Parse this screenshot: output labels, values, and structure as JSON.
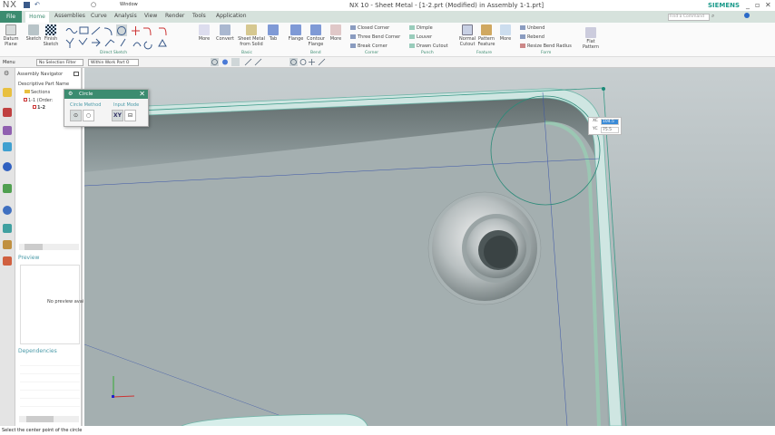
{
  "app": {
    "logo": "NX",
    "title": "NX 10 - Sheet Metal - [1-2.prt (Modified)  in Assembly 1-1.prt]",
    "brand": "SIEMENS",
    "window_menu": "Window",
    "accent": "#3c8c70"
  },
  "tabs": [
    "File",
    "Home",
    "Assemblies",
    "Curve",
    "Analysis",
    "View",
    "Render",
    "Tools",
    "Application"
  ],
  "search": {
    "placeholder": "Find a Command"
  },
  "ribbon": {
    "datum": "Datum Plane",
    "sketch": "Sketch",
    "finish_sketch": "Finish Sketch",
    "more1": "More",
    "direct_sketch": "Direct Sketch",
    "convert": "Convert",
    "sheet_metal_from_solid": "Sheet Metal from Solid",
    "tab": "Tab",
    "basic": "Basic",
    "flange": "Flange",
    "contour_flange": "Contour Flange",
    "more2": "More",
    "bend": "Bend",
    "corner_items": [
      "Closed Corner",
      "Three Bend Corner",
      "Break Corner"
    ],
    "corner": "Corner",
    "punch_items": [
      "Dimple",
      "Louver",
      "Drawn Cutout"
    ],
    "punch": "Punch",
    "normal_cutout": "Normal Cutout",
    "pattern_feature": "Pattern Feature",
    "more3": "More",
    "feature": "Feature",
    "form_items": [
      "Unbend",
      "Rebend",
      "Resize Bend Radius"
    ],
    "form": "Form",
    "flat_pattern": "Flat Pattern"
  },
  "toolbar": {
    "menu": "Menu",
    "selection_filter": "No Selection Filter",
    "scope": "Within Work Part O"
  },
  "navigator": {
    "title": "Assembly Navigator",
    "column": "Descriptive Part Name",
    "items": [
      "Sections",
      "1-1 (Order:",
      "1-2"
    ],
    "preview": "Preview",
    "no_preview": "No preview avai",
    "dependencies": "Dependencies"
  },
  "dialog": {
    "title": "Circle",
    "circle_method": "Circle Method",
    "input_mode": "Input Mode",
    "xy": "XY"
  },
  "coords": {
    "xc_label": "XC",
    "xc": "104.5",
    "yc_label": "YC",
    "yc": "75.5"
  },
  "status": "Select the center point of the circle"
}
